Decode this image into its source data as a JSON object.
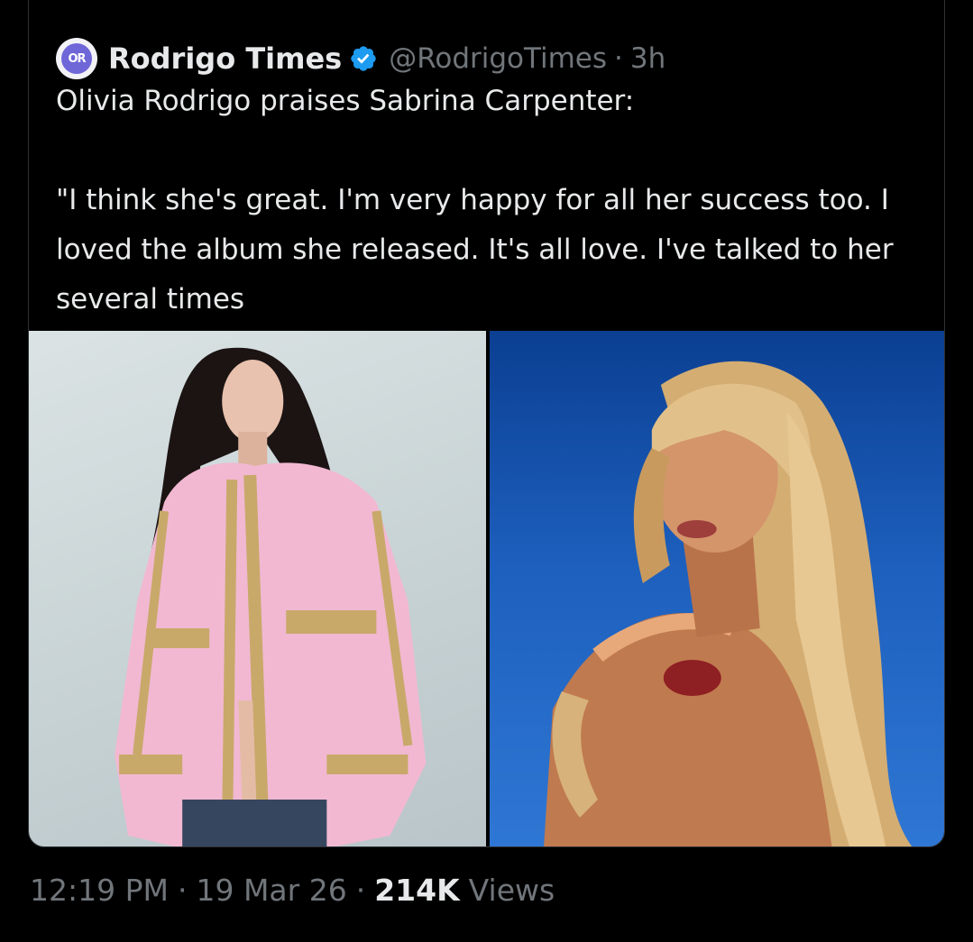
{
  "tweet": {
    "author": {
      "display_name": "Rodrigo Times",
      "handle": "@RodrigoTimes",
      "avatar_text": "OR",
      "verified_icon": "verified-badge-icon"
    },
    "separator": "·",
    "relative_time": "3h",
    "text": "Olivia Rodrigo praises Sabrina Carpenter:\n\n\"I think she's great. I'm very happy for all her success too. I loved the album she released. It's all love. I've talked to her several times",
    "media": [
      {
        "name": "photo-olivia-rodrigo"
      },
      {
        "name": "photo-sabrina-carpenter"
      }
    ],
    "footer": {
      "time": "12:19 PM",
      "date": "19 Mar 26",
      "views_count": "214K",
      "views_label": "Views"
    }
  },
  "colors": {
    "background": "#000000",
    "text_primary": "#e7e9ea",
    "text_secondary": "#71767b",
    "verified": "#1d9bf0",
    "border": "#2f3336"
  }
}
